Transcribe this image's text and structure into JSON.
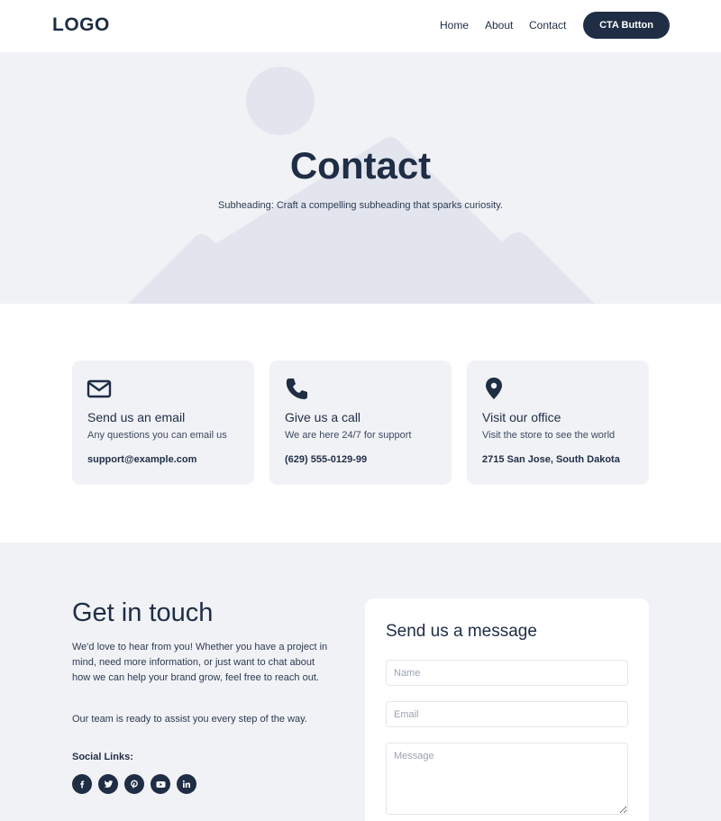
{
  "header": {
    "logo": "LOGO",
    "nav": [
      "Home",
      "About",
      "Contact"
    ],
    "cta_label": "CTA Button"
  },
  "hero": {
    "title": "Contact",
    "subheading": "Subheading: Craft a compelling subheading that sparks curiosity."
  },
  "cards": [
    {
      "icon": "envelope-icon",
      "title": "Send us an email",
      "description": "Any questions you can email us",
      "value": "support@example.com"
    },
    {
      "icon": "phone-icon",
      "title": "Give us a call",
      "description": "We are here 24/7 for support",
      "value": "(629) 555-0129-99"
    },
    {
      "icon": "map-pin-icon",
      "title": "Visit our office",
      "description": "Visit the store to see the world",
      "value": "2715 San Jose, South Dakota"
    }
  ],
  "touch": {
    "title": "Get in touch",
    "paragraph1": "We'd love to hear from you! Whether you have a project in mind, need more information, or just want to chat about how we can help your brand grow, feel free to reach out.",
    "paragraph2": "Our team is ready to assist you every step of the way.",
    "social_label": "Social Links:",
    "social_icons": [
      "facebook-icon",
      "twitter-icon",
      "pinterest-icon",
      "youtube-icon",
      "linkedin-icon"
    ]
  },
  "form": {
    "title": "Send us a message",
    "name_placeholder": "Name",
    "email_placeholder": "Email",
    "message_placeholder": "Message"
  },
  "colors": {
    "primary": "#1f2d45",
    "section_bg": "#f1f2f6",
    "placeholder_art": "#e2e5ee"
  }
}
